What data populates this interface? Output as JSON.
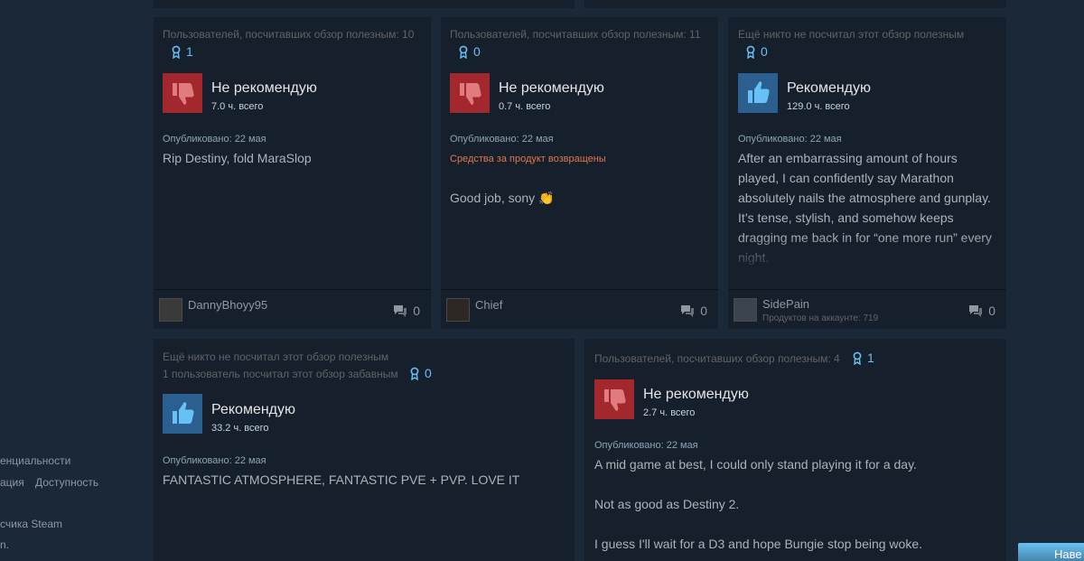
{
  "footer": {
    "privacy_fragment": "енциальности",
    "legal_fragment": "ация",
    "accessibility": "Доступность",
    "steam_fragment": "счика Steam",
    "misc_fragment": "n."
  },
  "reviews": [
    {
      "helpful": "Пользователей, посчитавших обзор полезным: 10",
      "award_count": "1",
      "verdict": "Не рекомендую",
      "recommended": false,
      "hours": "7.0 ч. всего",
      "posted": "Опубликовано: 22 мая",
      "text": "Rip Destiny, fold MaraSlop",
      "author": "DannyBhoyy95",
      "comments": "0"
    },
    {
      "helpful": "Пользователей, посчитавших обзор полезным: 11",
      "award_count": "0",
      "verdict": "Не рекомендую",
      "recommended": false,
      "hours": "0.7 ч. всего",
      "posted": "Опубликовано: 22 мая",
      "refund": "Средства за продукт возвращены",
      "text": "Good job, sony 👏",
      "author": "Chief",
      "comments": "0"
    },
    {
      "helpful": "Ещё никто не посчитал этот обзор полезным",
      "award_count": "0",
      "verdict": "Рекомендую",
      "recommended": true,
      "hours": "129.0 ч. всего",
      "posted": "Опубликовано: 22 мая",
      "text": "After an embarrassing amount of hours played, I can confidently say Marathon absolutely nails the atmosphere and gunplay. It’s tense, stylish, and somehow keeps dragging me back in for “one more run” every night.",
      "author": "SidePain",
      "products": "Продуктов на аккаунте: 719",
      "comments": "0"
    },
    {
      "helpful": "Ещё никто не посчитал этот обзор полезным",
      "funny": "1 пользователь посчитал этот обзор забавным",
      "award_count": "0",
      "verdict": "Рекомендую",
      "recommended": true,
      "hours": "33.2 ч. всего",
      "posted": "Опубликовано: 22 мая",
      "text": "FANTASTIC ATMOSPHERE, FANTASTIC PVE + PVP. LOVE IT"
    },
    {
      "helpful": "Пользователей, посчитавших обзор полезным: 4",
      "award_count": "1",
      "verdict": "Не рекомендую",
      "recommended": false,
      "hours": "2.7 ч. всего",
      "posted": "Опубликовано: 22 мая",
      "text_lines": [
        "A mid game at best, I could only stand playing it for a day.",
        "Not as good as Destiny 2.",
        "I guess I'll wait for a D3 and hope Bungie stop being woke."
      ]
    }
  ],
  "next_button": "Наве",
  "colors": {
    "page_bg": "#1b2838",
    "card_bg": "#16202d",
    "thumb_down": "#a3282e",
    "thumb_up": "#2a5f8f",
    "link_blue": "#66c0f4",
    "refund_orange": "#e0774b"
  }
}
